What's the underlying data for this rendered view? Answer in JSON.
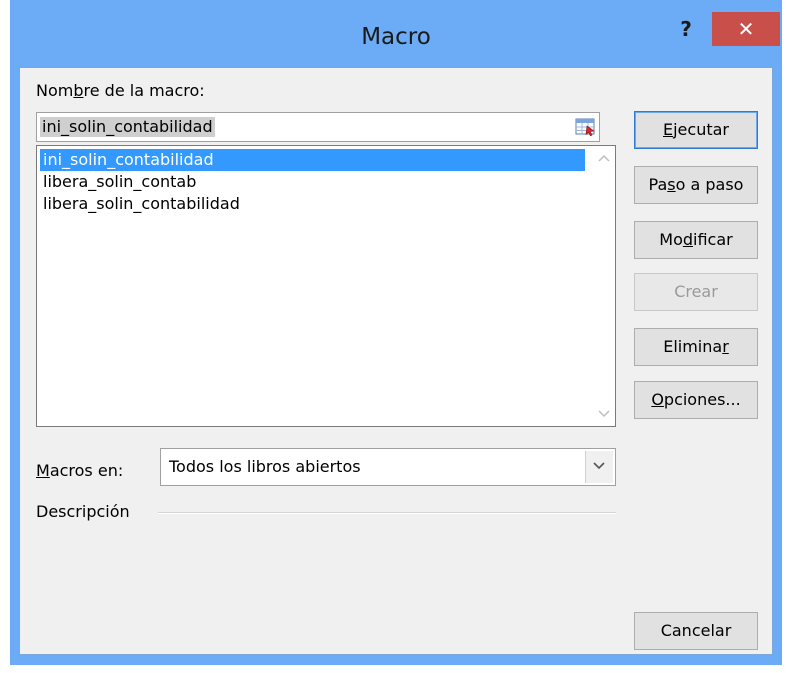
{
  "window": {
    "title": "Macro",
    "help_glyph": "?",
    "close_glyph": "✕",
    "colors": {
      "titlebar": "#6cabf5",
      "close_button": "#c9504a",
      "selection": "#3399ff"
    }
  },
  "labels": {
    "name_pre": "Nom",
    "name_key": "b",
    "name_post": "re de la macro:",
    "macros_en_key": "M",
    "macros_en_post": "acros en:",
    "descripcion": "Descripción"
  },
  "name_input": {
    "value": "ini_solin_contabilidad",
    "picker_icon": "range-picker-icon"
  },
  "macro_list": {
    "items": [
      {
        "label": "ini_solin_contabilidad",
        "selected": true
      },
      {
        "label": "libera_solin_contab",
        "selected": false
      },
      {
        "label": "libera_solin_contabilidad",
        "selected": false
      }
    ]
  },
  "buttons": {
    "ejecutar": {
      "key": "E",
      "rest": "jecutar"
    },
    "paso_a_paso": {
      "pre": "Pa",
      "key": "s",
      "rest": "o a paso"
    },
    "modificar": {
      "pre": "Mo",
      "key": "d",
      "rest": "ificar"
    },
    "crear": {
      "label": "Crear",
      "disabled": true
    },
    "eliminar": {
      "pre": "Elimina",
      "key": "r",
      "rest": ""
    },
    "opciones": {
      "key": "O",
      "rest": "pciones..."
    },
    "cancelar": {
      "label": "Cancelar"
    }
  },
  "macros_en_select": {
    "value": "Todos los libros abiertos"
  }
}
